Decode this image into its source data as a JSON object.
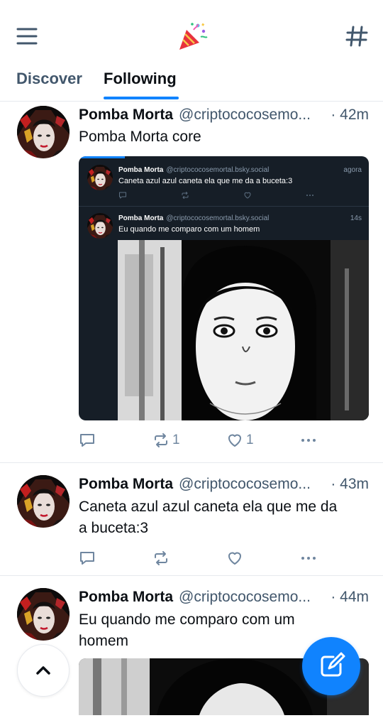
{
  "tabs": [
    {
      "label": "Discover",
      "active": false
    },
    {
      "label": "Following",
      "active": true
    }
  ],
  "icons": {
    "menu": "menu-icon",
    "logo": "party-popper-icon",
    "feeds": "hash-icon",
    "reply": "reply-icon",
    "repost": "repost-icon",
    "like": "heart-icon",
    "more": "more-icon",
    "scroll_top": "chevron-up-icon",
    "compose": "compose-icon"
  },
  "colors": {
    "accent": "#1083fe",
    "muted": "#42576c",
    "action": "#6f869f"
  },
  "posts": [
    {
      "author": "Pomba Morta",
      "handle": "@criptococosemo...",
      "time": "· 42m",
      "text": "Pomba Morta core",
      "reply_count": "",
      "repost_count": "1",
      "like_count": "1",
      "embed": {
        "items": [
          {
            "author": "Pomba Morta",
            "handle": "@criptococosemortal.bsky.social",
            "time": "agora",
            "text": "Caneta azul azul caneta ela que me da a buceta:3"
          },
          {
            "author": "Pomba Morta",
            "handle": "@criptococosemortal.bsky.social",
            "time": "14s",
            "text": "Eu quando me comparo com um homem"
          }
        ]
      }
    },
    {
      "author": "Pomba Morta",
      "handle": "@criptococosemo...",
      "time": "· 43m",
      "text_line1": "Caneta azul azul caneta ela que me da",
      "text_line2": "a buceta:3",
      "reply_count": "",
      "repost_count": "",
      "like_count": ""
    },
    {
      "author": "Pomba Morta",
      "handle": "@criptococosemo...",
      "time": "· 44m",
      "text_line1": "Eu quando me comparo com um",
      "text_line2": "homem"
    }
  ]
}
